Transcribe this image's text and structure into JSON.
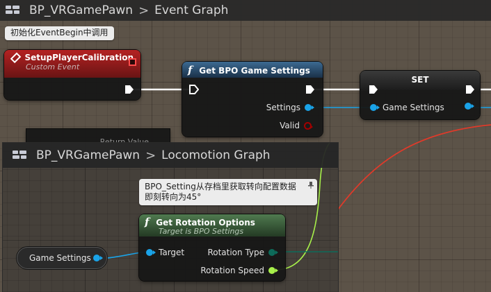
{
  "event_graph": {
    "breadcrumb": {
      "blueprint": "BP_VRGamePawn",
      "separator": ">",
      "graph": "Event Graph"
    }
  },
  "comment_event": {
    "text": "初始化EventBegin中调用"
  },
  "event_node": {
    "title": "SetupPlayerCalibration",
    "subtitle": "Custom Event",
    "header_color": "#8a1c1c"
  },
  "get_settings_node": {
    "title": "Get BPO Game Settings",
    "func_icon": "f",
    "pins": {
      "settings": "Settings",
      "valid": "Valid"
    },
    "header_color": "#2d4f6e"
  },
  "set_node": {
    "title": "SET",
    "pins": {
      "game_settings": "Game Settings"
    }
  },
  "hidden_return": {
    "text": "Return Value"
  },
  "locomotion_graph": {
    "breadcrumb": {
      "blueprint": "BP_VRGamePawn",
      "separator": ">",
      "graph": "Locomotion Graph"
    }
  },
  "comment_rotation": {
    "line1": "BPO_Setting从存档里获取转向配置数据",
    "line2": "即刻转向为45°"
  },
  "rotation_node": {
    "title": "Get Rotation Options",
    "func_icon": "f",
    "subtitle": "Target is BPO Settings",
    "pins": {
      "target": "Target",
      "rotation_type": "Rotation Type",
      "rotation_speed": "Rotation Speed"
    },
    "header_color": "#3e5f3e"
  },
  "game_settings_var": {
    "label": "Game Settings"
  },
  "colors": {
    "object_pin": "#1aa3e8",
    "exec_wire": "#ffffff",
    "bool_pin": "#8f0000",
    "enum_pin": "#0d6b5a",
    "float_pin": "#a7f04a",
    "red_wire": "#e03a2a"
  }
}
